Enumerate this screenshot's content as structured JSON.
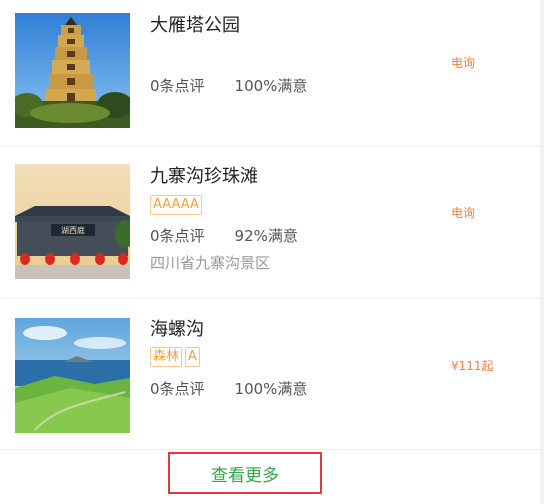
{
  "items": [
    {
      "title": "大雁塔公园",
      "tags": [],
      "reviews": "0条点评",
      "satisfaction": "100%满意",
      "address": "",
      "price": "电询"
    },
    {
      "title": "九寨沟珍珠滩",
      "tags": [
        "AAAAA"
      ],
      "reviews": "0条点评",
      "satisfaction": "92%满意",
      "address": "四川省九寨沟景区",
      "price": "电询"
    },
    {
      "title": "海螺沟",
      "tags": [
        "森林",
        "A"
      ],
      "reviews": "0条点评",
      "satisfaction": "100%满意",
      "address": "",
      "price": "¥111起"
    }
  ],
  "more_label": "查看更多",
  "colors": {
    "price": "#f08040",
    "tag": "#f0a040",
    "more": "#3aa04a",
    "highlight_box": "#e03a3a"
  }
}
